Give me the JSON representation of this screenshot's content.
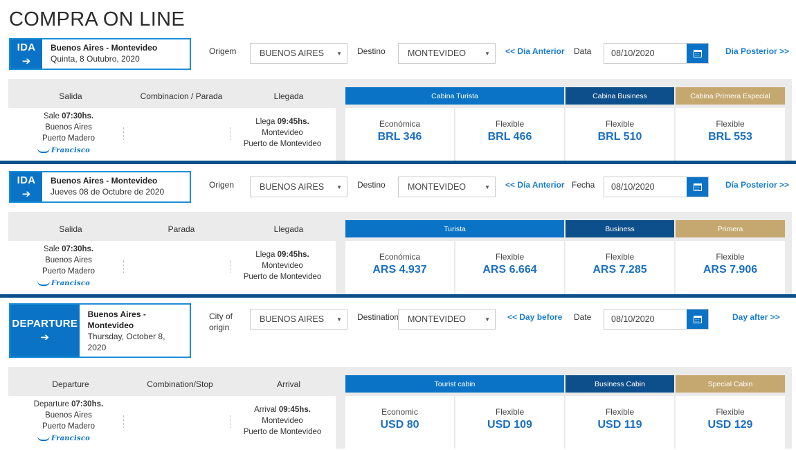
{
  "page_title": "COMPRA ON LINE",
  "sections": [
    {
      "trip_badge": "IDA",
      "trip_route": "Buenos Aires - Montevideo",
      "trip_date": "Quinta, 8 Outubro, 2020",
      "origin_label": "Origem",
      "origin_value": "BUENOS AIRES",
      "destination_label": "Destino",
      "destination_value": "MONTEVIDEO",
      "prev_day": "<< Dia Anterior",
      "date_label": "Data",
      "date_value": "08/10/2020",
      "next_day": "Dia Posterior >>",
      "col_departure": "Salida",
      "col_stop": "Combinacion / Parada",
      "col_arrival": "Llegada",
      "cabins": [
        "Cabina Turista",
        "Cabina Business",
        "Cabina Primera Especial"
      ],
      "dep_prefix": "Sale",
      "dep_time": "07:30",
      "dep_suffix": "hs.",
      "dep_city": "Buenos Aires",
      "dep_port": "Puerto Madero",
      "arr_prefix": "Llega",
      "arr_time": "09:45",
      "arr_suffix": "hs.",
      "arr_city": "Montevideo",
      "arr_port": "Puerto de Montevideo",
      "ship": "Francisco",
      "fares": [
        {
          "name": "Económica",
          "price": "BRL 346"
        },
        {
          "name": "Flexible",
          "price": "BRL 466"
        },
        {
          "name": "Flexible",
          "price": "BRL 510"
        },
        {
          "name": "Flexible",
          "price": "BRL 553"
        }
      ]
    },
    {
      "trip_badge": "IDA",
      "trip_route": "Buenos Aires - Montevideo",
      "trip_date": "Jueves 08 de Octubre de 2020",
      "origin_label": "Origen",
      "origin_value": "BUENOS AIRES",
      "destination_label": "Destino",
      "destination_value": "MONTEVIDEO",
      "prev_day": "<< Día Anterior",
      "date_label": "Fecha",
      "date_value": "08/10/2020",
      "next_day": "Día Posterior >>",
      "col_departure": "Salida",
      "col_stop": "Parada",
      "col_arrival": "Llegada",
      "cabins": [
        "Turista",
        "Business",
        "Primera"
      ],
      "dep_prefix": "Sale",
      "dep_time": "07:30",
      "dep_suffix": "hs.",
      "dep_city": "Buenos Aires",
      "dep_port": "Puerto Madero",
      "arr_prefix": "Llega",
      "arr_time": "09:45",
      "arr_suffix": "hs.",
      "arr_city": "Montevideo",
      "arr_port": "Puerto de Montevideo",
      "ship": "Francisco",
      "fares": [
        {
          "name": "Económica",
          "price": "ARS 4.937"
        },
        {
          "name": "Flexible",
          "price": "ARS 6.664"
        },
        {
          "name": "Flexible",
          "price": "ARS 7.285"
        },
        {
          "name": "Flexible",
          "price": "ARS 7.906"
        }
      ]
    },
    {
      "trip_badge": "DEPARTURE",
      "trip_route": "Buenos Aires - Montevideo",
      "trip_date": "Thursday, October 8, 2020",
      "origin_label": "City of origin",
      "origin_value": "BUENOS AIRES",
      "destination_label": "Destination",
      "destination_value": "MONTEVIDEO",
      "prev_day": "<< Day before",
      "date_label": "Date",
      "date_value": "08/10/2020",
      "next_day": "Day after >>",
      "col_departure": "Departure",
      "col_stop": "Combination/Stop",
      "col_arrival": "Arrival",
      "cabins": [
        "Tourist cabin",
        "Business Cabin",
        "Special Cabin"
      ],
      "dep_prefix": "Departure",
      "dep_time": "07:30",
      "dep_suffix": "hs.",
      "dep_city": "Buenos Aires",
      "dep_port": "Puerto Madero",
      "arr_prefix": "Arrival",
      "arr_time": "09:45",
      "arr_suffix": "hs.",
      "arr_city": "Montevideo",
      "arr_port": "Puerto de Montevideo",
      "ship": "Francisco",
      "fares": [
        {
          "name": "Economic",
          "price": "USD 80"
        },
        {
          "name": "Flexible",
          "price": "USD 109"
        },
        {
          "name": "Flexible",
          "price": "USD 119"
        },
        {
          "name": "Flexible",
          "price": "USD 129"
        }
      ]
    }
  ],
  "icons": {
    "calendar": "calendar-icon",
    "arrow": "arrow-right-icon",
    "caret": "chevron-down-icon"
  },
  "colors": {
    "primary": "#0a73c6",
    "business": "#0d4f8b",
    "primera": "#c5a86f",
    "price": "#1a6fc0"
  }
}
